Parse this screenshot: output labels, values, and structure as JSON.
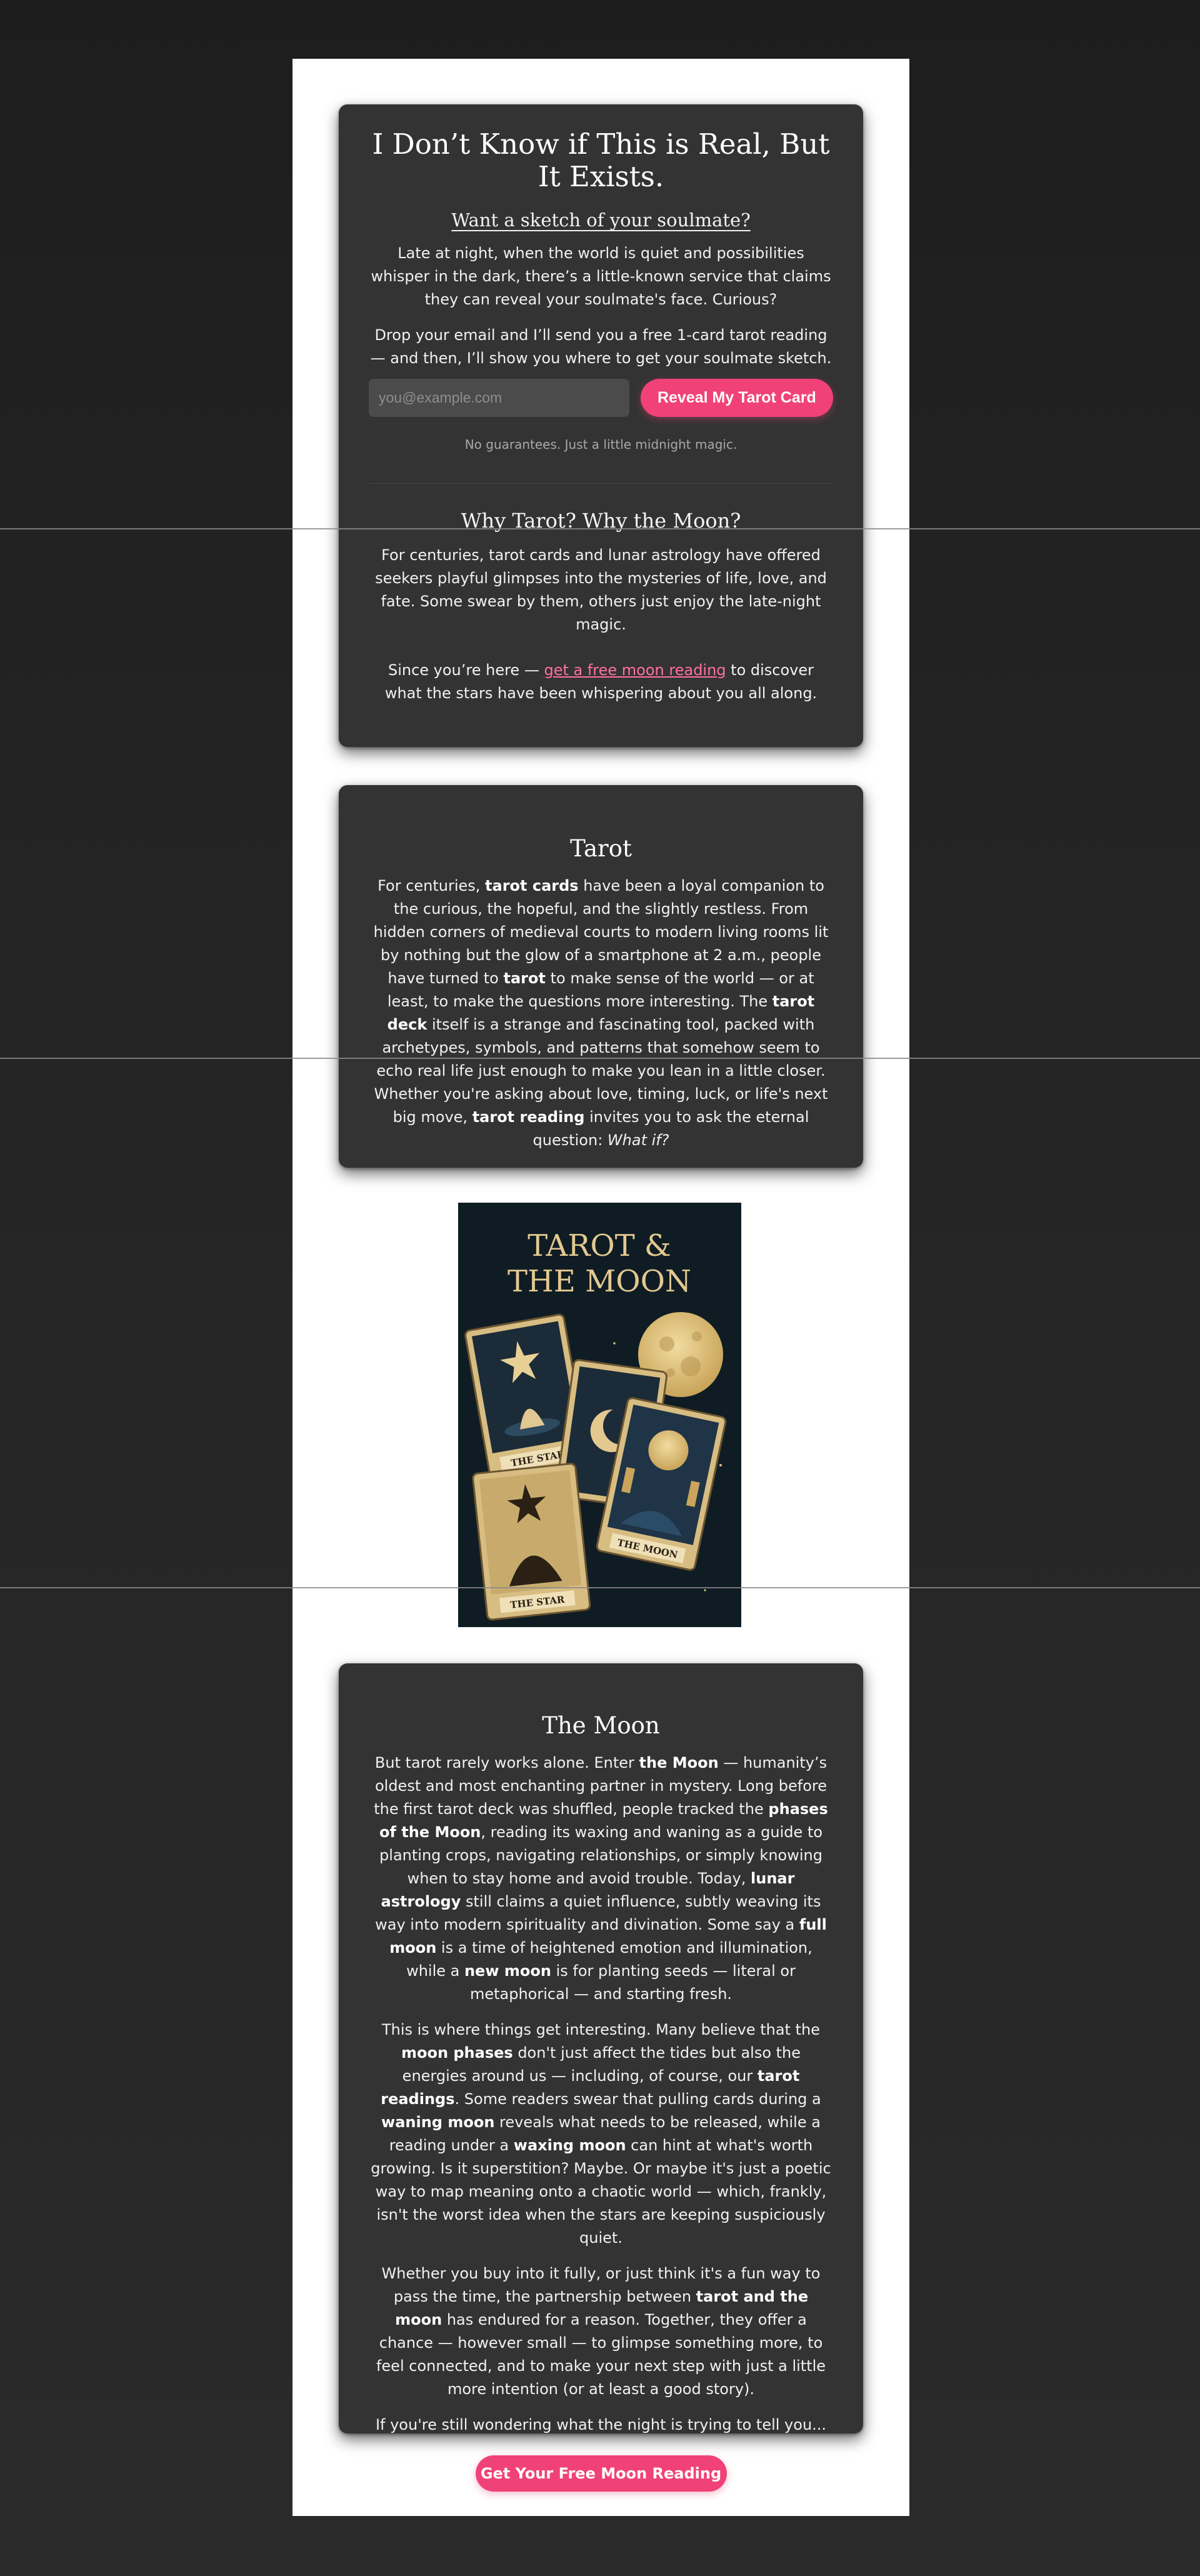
{
  "hero": {
    "title": "I Don’t Know if This is Real, But It Exists.",
    "subtitle": "Want a sketch of your soulmate?",
    "intro": "Late at night, when the world is quiet and possibilities whisper in the dark, there’s a little-known service that claims they can reveal your soulmate's face. Curious?",
    "offer": "Drop your email and I’ll send you a free 1-card tarot reading — and then, I’ll show you where to get your soulmate sketch.",
    "email_placeholder": "you@example.com",
    "email_value": "",
    "button_label": "Reveal My Tarot Card",
    "note": "No guarantees. Just a little midnight magic."
  },
  "why": {
    "heading": "Why Tarot? Why the Moon?",
    "paragraph": "For centuries, tarot cards and lunar astrology have offered seekers playful glimpses into the mysteries of life, love, and fate. Some swear by them, others just enjoy the late-night magic.",
    "link_prefix": "Since you’re here — ",
    "link_text": "get a free moon reading",
    "link_suffix": " to discover what the stars have been whispering about you all along."
  },
  "tarot": {
    "heading": "Tarot",
    "segments": [
      {
        "t": "For centuries, "
      },
      {
        "t": "tarot cards",
        "b": true
      },
      {
        "t": " have been a loyal companion to the curious, the hopeful, and the slightly restless. From hidden corners of medieval courts to modern living rooms lit by nothing but the glow of a smartphone at 2 a.m., people have turned to "
      },
      {
        "t": "tarot",
        "b": true
      },
      {
        "t": " to make sense of the world — or at least, to make the questions more interesting. The "
      },
      {
        "t": "tarot deck",
        "b": true
      },
      {
        "t": " itself is a strange and fascinating tool, packed with archetypes, symbols, and patterns that somehow seem to echo real life just enough to make you lean in a little closer. Whether you're asking about love, timing, luck, or life's next big move, "
      },
      {
        "t": "tarot reading",
        "b": true
      },
      {
        "t": " invites you to ask the eternal question: "
      },
      {
        "t": "What if?",
        "i": true
      }
    ]
  },
  "poster": {
    "title_line1": "TAROT &",
    "title_line2": "THE MOON",
    "card_labels": [
      "THE STAR",
      "THE MOON",
      "THE STAR"
    ]
  },
  "moon": {
    "heading": "The Moon",
    "paragraphs": [
      [
        {
          "t": "But tarot rarely works alone. Enter "
        },
        {
          "t": "the Moon",
          "b": true
        },
        {
          "t": " — humanity’s oldest and most enchanting partner in mystery. Long before the first tarot deck was shuffled, people tracked the "
        },
        {
          "t": "phases of the Moon",
          "b": true
        },
        {
          "t": ", reading its waxing and waning as a guide to planting crops, navigating relationships, or simply knowing when to stay home and avoid trouble. Today, "
        },
        {
          "t": "lunar astrology",
          "b": true
        },
        {
          "t": " still claims a quiet influence, subtly weaving its way into modern spirituality and divination. Some say a "
        },
        {
          "t": "full moon",
          "b": true
        },
        {
          "t": " is a time of heightened emotion and illumination, while a "
        },
        {
          "t": "new moon",
          "b": true
        },
        {
          "t": " is for planting seeds — literal or metaphorical — and starting fresh."
        }
      ],
      [
        {
          "t": "This is where things get interesting. Many believe that the "
        },
        {
          "t": "moon phases",
          "b": true
        },
        {
          "t": " don't just affect the tides but also the energies around us — including, of course, our "
        },
        {
          "t": "tarot readings",
          "b": true
        },
        {
          "t": ". Some readers swear that pulling cards during a "
        },
        {
          "t": "waning moon",
          "b": true
        },
        {
          "t": " reveals what needs to be released, while a reading under a "
        },
        {
          "t": "waxing moon",
          "b": true
        },
        {
          "t": " can hint at what's worth growing. Is it superstition? Maybe. Or maybe it's just a poetic way to map meaning onto a chaotic world — which, frankly, isn't the worst idea when the stars are keeping suspiciously quiet."
        }
      ],
      [
        {
          "t": "Whether you buy into it fully, or just think it's a fun way to pass the time, the partnership between "
        },
        {
          "t": "tarot and the moon",
          "b": true
        },
        {
          "t": " has endured for a reason. Together, they offer a chance — however small — to glimpse something more, to feel connected, and to make your next step with just a little more intention (or at least a good story)."
        }
      ],
      [
        {
          "t": "If you're still wondering what the night is trying to tell you..."
        }
      ]
    ],
    "cta_label": "Get Your Free Moon Reading"
  },
  "colors": {
    "accent": "#f04279",
    "link": "#ff6fa3",
    "card_bg": "#333333",
    "page_bg": "#ffffff",
    "body_bg": "#222222",
    "poster_bg": "#0f1c24",
    "gold": "#d9bf84"
  }
}
